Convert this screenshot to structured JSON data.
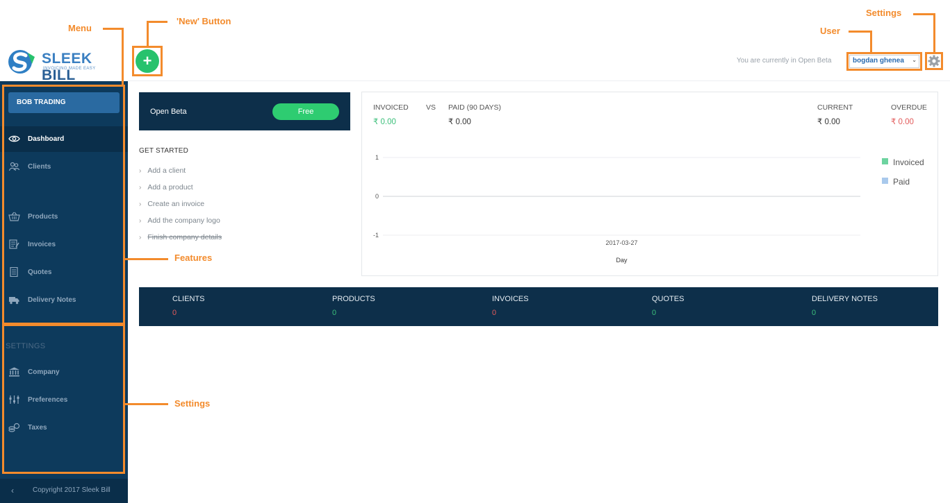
{
  "colors": {
    "accent_orange": "#f38b2c",
    "sidebar": "#0d3a5c",
    "brand_green": "#27c26d",
    "dark_panel": "#0d2f4a",
    "positive": "#3bbf7a",
    "negative": "#e25a5a"
  },
  "header": {
    "logo_primary": "SLEEK",
    "logo_secondary": "BILL",
    "logo_tagline": "INVOICING MADE EASY",
    "new_button_icon": "+",
    "beta_notice": "You are currently in Open Beta",
    "user_name": "bogdan ghenea",
    "settings_icon": "gear-icon"
  },
  "sidebar": {
    "company": "BOB TRADING",
    "items": [
      {
        "label": "Dashboard",
        "icon": "eye-icon"
      },
      {
        "label": "Clients",
        "icon": "users-icon"
      },
      {
        "label": "Products",
        "icon": "basket-icon"
      },
      {
        "label": "Invoices",
        "icon": "invoice-icon"
      },
      {
        "label": "Quotes",
        "icon": "document-icon"
      },
      {
        "label": "Delivery Notes",
        "icon": "truck-icon"
      }
    ],
    "settings_heading": "SETTINGS",
    "settings_items": [
      {
        "label": "Company",
        "icon": "bank-icon"
      },
      {
        "label": "Preferences",
        "icon": "sliders-icon"
      },
      {
        "label": "Taxes",
        "icon": "coins-icon"
      }
    ],
    "footer_chevron": "‹",
    "footer": "Copyright 2017 Sleek Bill"
  },
  "plan": {
    "name": "Open Beta",
    "badge": "Free"
  },
  "get_started": {
    "title": "GET STARTED",
    "items": [
      {
        "label": "Add a client",
        "done": false
      },
      {
        "label": "Add a product",
        "done": false
      },
      {
        "label": "Create an invoice",
        "done": false
      },
      {
        "label": "Add the company logo",
        "done": false
      },
      {
        "label": "Finish company details",
        "done": true
      }
    ]
  },
  "stats": {
    "invoiced_label": "INVOICED",
    "vs_label": "VS",
    "paid_label": "PAID (90 DAYS)",
    "current_label": "CURRENT",
    "overdue_label": "OVERDUE",
    "invoiced_value": "₹ 0.00",
    "paid_value": "₹ 0.00",
    "current_value": "₹ 0.00",
    "overdue_value": "₹ 0.00"
  },
  "chart_data": {
    "type": "line",
    "x": [
      "2017-03-27"
    ],
    "series": [
      {
        "name": "Invoiced",
        "values": [
          0
        ],
        "color": "#6dd3a0"
      },
      {
        "name": "Paid",
        "values": [
          0
        ],
        "color": "#a9c9ec"
      }
    ],
    "yticks": [
      1,
      0,
      -1
    ],
    "ylim": [
      -1,
      1
    ],
    "xlabel": "Day",
    "ylabel": "",
    "grid": true,
    "legend": "right"
  },
  "counts": [
    {
      "label": "CLIENTS",
      "value": "0",
      "color": "#e25a5a"
    },
    {
      "label": "PRODUCTS",
      "value": "0",
      "color": "#3bbf7a"
    },
    {
      "label": "INVOICES",
      "value": "0",
      "color": "#e25a5a"
    },
    {
      "label": "QUOTES",
      "value": "0",
      "color": "#3bbf7a"
    },
    {
      "label": "DELIVERY NOTES",
      "value": "0",
      "color": "#3bbf7a"
    }
  ],
  "annotations": {
    "menu": "Menu",
    "new_button": "'New' Button",
    "settings_top": "Settings",
    "user": "User",
    "features": "Features",
    "settings_side": "Settings"
  }
}
